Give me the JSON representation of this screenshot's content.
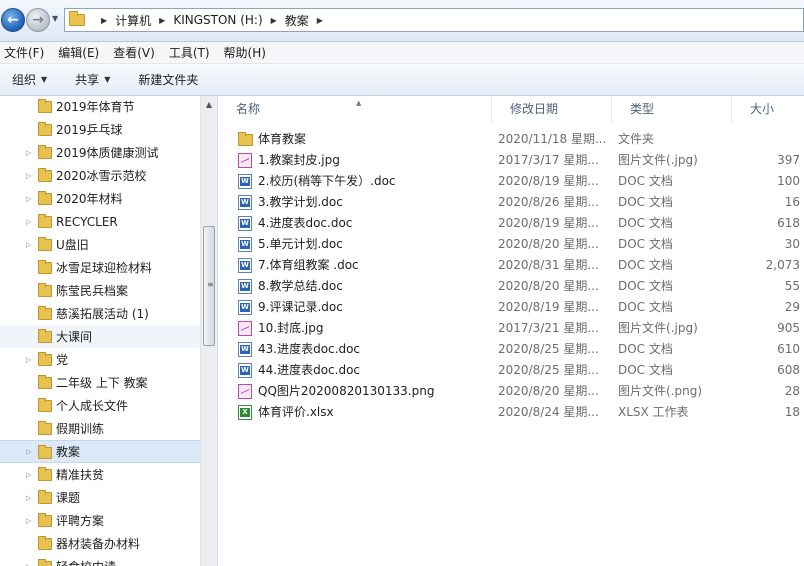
{
  "address": {
    "crumbs": [
      "计算机",
      "KINGSTON (H:)",
      "教案"
    ]
  },
  "menu": [
    "文件(F)",
    "编辑(E)",
    "查看(V)",
    "工具(T)",
    "帮助(H)"
  ],
  "commands": {
    "organize": "组织",
    "share": "共享",
    "new_folder": "新建文件夹"
  },
  "tree": [
    {
      "label": "2019年体育节",
      "expandable": false
    },
    {
      "label": "2019乒乓球",
      "expandable": false
    },
    {
      "label": "2019体质健康测试",
      "expandable": true
    },
    {
      "label": "2020冰雪示范校",
      "expandable": true
    },
    {
      "label": "2020年材料",
      "expandable": true
    },
    {
      "label": "RECYCLER",
      "expandable": true
    },
    {
      "label": "U盘旧",
      "expandable": true
    },
    {
      "label": "冰雪足球迎检材料",
      "expandable": false
    },
    {
      "label": "陈莹民兵档案",
      "expandable": false
    },
    {
      "label": "慈溪拓展活动 (1)",
      "expandable": false
    },
    {
      "label": "大课间",
      "expandable": false,
      "hover": true
    },
    {
      "label": "党",
      "expandable": true
    },
    {
      "label": "二年级 上下 教案",
      "expandable": false
    },
    {
      "label": "个人成长文件",
      "expandable": false
    },
    {
      "label": "假期训练",
      "expandable": false
    },
    {
      "label": "教案",
      "expandable": true,
      "selected": true
    },
    {
      "label": "精准扶贫",
      "expandable": true
    },
    {
      "label": "课题",
      "expandable": true
    },
    {
      "label": "评聘方案",
      "expandable": true
    },
    {
      "label": "器材装备办材料",
      "expandable": false
    },
    {
      "label": "轻食校内请",
      "expandable": true
    }
  ],
  "columns": {
    "name": "名称",
    "date": "修改日期",
    "type": "类型",
    "size": "大小"
  },
  "files": [
    {
      "icon": "folder",
      "name": "体育教案",
      "date": "2020/11/18 星期...",
      "type": "文件夹",
      "size": ""
    },
    {
      "icon": "img",
      "name": "1.教案封皮.jpg",
      "date": "2017/3/17 星期...",
      "type": "图片文件(.jpg)",
      "size": "397"
    },
    {
      "icon": "doc",
      "name": "2.校历(稍等下午发）.doc",
      "date": "2020/8/19 星期...",
      "type": "DOC 文档",
      "size": "100"
    },
    {
      "icon": "doc",
      "name": "3.教学计划.doc",
      "date": "2020/8/26 星期...",
      "type": "DOC 文档",
      "size": "16"
    },
    {
      "icon": "doc",
      "name": "4.进度表doc.doc",
      "date": "2020/8/19 星期...",
      "type": "DOC 文档",
      "size": "618"
    },
    {
      "icon": "doc",
      "name": "5.单元计划.doc",
      "date": "2020/8/20 星期...",
      "type": "DOC 文档",
      "size": "30"
    },
    {
      "icon": "doc",
      "name": "7.体育组教案 .doc",
      "date": "2020/8/31 星期...",
      "type": "DOC 文档",
      "size": "2,073"
    },
    {
      "icon": "doc",
      "name": "8.教学总结.doc",
      "date": "2020/8/20 星期...",
      "type": "DOC 文档",
      "size": "55"
    },
    {
      "icon": "doc",
      "name": "9.评课记录.doc",
      "date": "2020/8/19 星期...",
      "type": "DOC 文档",
      "size": "29"
    },
    {
      "icon": "img",
      "name": "10.封底.jpg",
      "date": "2017/3/21 星期...",
      "type": "图片文件(.jpg)",
      "size": "905"
    },
    {
      "icon": "doc",
      "name": "43.进度表doc.doc",
      "date": "2020/8/25 星期...",
      "type": "DOC 文档",
      "size": "610"
    },
    {
      "icon": "doc",
      "name": "44.进度表doc.doc",
      "date": "2020/8/25 星期...",
      "type": "DOC 文档",
      "size": "608"
    },
    {
      "icon": "img",
      "name": "QQ图片20200820130133.png",
      "date": "2020/8/20 星期...",
      "type": "图片文件(.png)",
      "size": "28"
    },
    {
      "icon": "xls",
      "name": "体育评价.xlsx",
      "date": "2020/8/24 星期...",
      "type": "XLSX 工作表",
      "size": "18"
    }
  ]
}
